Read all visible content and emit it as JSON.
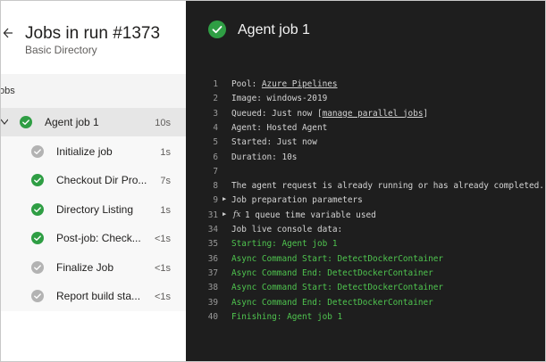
{
  "header": {
    "title": "Jobs in run #1373",
    "subtitle": "Basic Directory"
  },
  "section": {
    "label": "obs"
  },
  "jobs": [
    {
      "label": "Agent job 1",
      "time": "10s",
      "status": "success",
      "selected": true
    },
    {
      "label": "Initialize job",
      "time": "1s",
      "status": "skipped"
    },
    {
      "label": "Checkout Dir Pro...",
      "time": "7s",
      "status": "success"
    },
    {
      "label": "Directory Listing",
      "time": "1s",
      "status": "success"
    },
    {
      "label": "Post-job: Check...",
      "time": "<1s",
      "status": "success"
    },
    {
      "label": "Finalize Job",
      "time": "<1s",
      "status": "skipped"
    },
    {
      "label": "Report build sta...",
      "time": "<1s",
      "status": "skipped"
    }
  ],
  "detail": {
    "title": "Agent job 1"
  },
  "console": [
    {
      "n": "1",
      "parts": [
        "Pool: ",
        {
          "u": "Azure Pipelines"
        }
      ]
    },
    {
      "n": "2",
      "parts": [
        "Image: windows-2019"
      ]
    },
    {
      "n": "3",
      "parts": [
        "Queued: Just now [",
        {
          "u": "manage parallel jobs"
        },
        "]"
      ]
    },
    {
      "n": "4",
      "parts": [
        "Agent: Hosted Agent"
      ]
    },
    {
      "n": "5",
      "parts": [
        "Started: Just now"
      ]
    },
    {
      "n": "6",
      "parts": [
        "Duration: 10s"
      ]
    },
    {
      "n": "7",
      "parts": [
        ""
      ]
    },
    {
      "n": "8",
      "parts": [
        "The agent request is already running or has already completed."
      ]
    },
    {
      "n": "9",
      "parts": [
        "Job preparation parameters"
      ],
      "expander": true
    },
    {
      "n": "31",
      "parts": [
        "1 queue time variable used"
      ],
      "expander": true,
      "fx": "fx"
    },
    {
      "n": "34",
      "parts": [
        "Job live console data:"
      ]
    },
    {
      "n": "35",
      "parts": [
        "Starting: Agent job 1"
      ],
      "green": true
    },
    {
      "n": "36",
      "parts": [
        "Async Command Start: DetectDockerContainer"
      ],
      "green": true
    },
    {
      "n": "37",
      "parts": [
        "Async Command End: DetectDockerContainer"
      ],
      "green": true
    },
    {
      "n": "38",
      "parts": [
        "Async Command Start: DetectDockerContainer"
      ],
      "green": true
    },
    {
      "n": "39",
      "parts": [
        "Async Command End: DetectDockerContainer"
      ],
      "green": true
    },
    {
      "n": "40",
      "parts": [
        "Finishing: Agent job 1"
      ],
      "green": true
    }
  ],
  "colors": {
    "success": "#2f9e44",
    "skipped": "#b3b3b3",
    "console_bg": "#1e1e1e",
    "console_green": "#4fc44f"
  }
}
